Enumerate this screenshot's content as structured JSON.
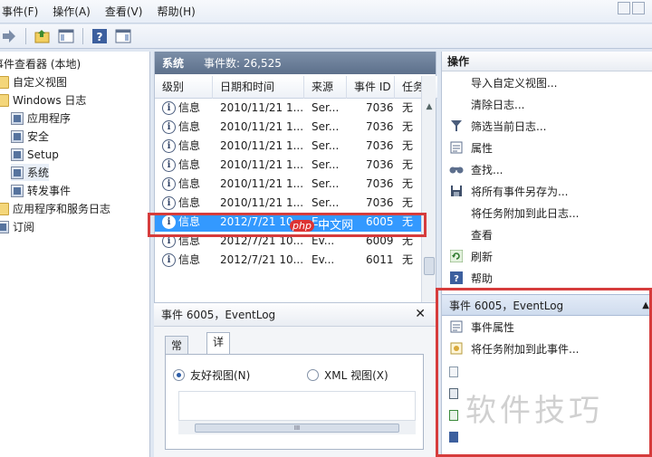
{
  "menu": [
    "事件(F)",
    "操作(A)",
    "查看(V)",
    "帮助(H)"
  ],
  "tree": {
    "items": [
      {
        "label": "事件查看器 (本地)",
        "icon": "event-viewer-icon"
      },
      {
        "label": "自定义视图",
        "icon": "folder-icon"
      },
      {
        "label": "Windows 日志",
        "icon": "folder-icon"
      },
      {
        "label": "应用程序",
        "icon": "log-icon"
      },
      {
        "label": "安全",
        "icon": "log-icon"
      },
      {
        "label": "Setup",
        "icon": "log-icon"
      },
      {
        "label": "系统",
        "icon": "log-icon"
      },
      {
        "label": "转发事件",
        "icon": "log-icon"
      },
      {
        "label": "应用程序和服务日志",
        "icon": "folder-icon"
      },
      {
        "label": "订阅",
        "icon": "log-icon"
      }
    ]
  },
  "log": {
    "name": "系统",
    "count_label": "事件数: 26,525"
  },
  "grid": {
    "columns": [
      "级别",
      "日期和时间",
      "来源",
      "事件 ID",
      "任务"
    ],
    "rows": [
      {
        "level": "信息",
        "datetime": "2010/11/21 1...",
        "source": "Ser...",
        "id": "7036",
        "task": "无"
      },
      {
        "level": "信息",
        "datetime": "2010/11/21 1...",
        "source": "Ser...",
        "id": "7036",
        "task": "无"
      },
      {
        "level": "信息",
        "datetime": "2010/11/21 1...",
        "source": "Ser...",
        "id": "7036",
        "task": "无"
      },
      {
        "level": "信息",
        "datetime": "2010/11/21 1...",
        "source": "Ser...",
        "id": "7036",
        "task": "无"
      },
      {
        "level": "信息",
        "datetime": "2010/11/21 1...",
        "source": "Ser...",
        "id": "7036",
        "task": "无"
      },
      {
        "level": "信息",
        "datetime": "2010/11/21 1...",
        "source": "Ser...",
        "id": "7036",
        "task": "无"
      },
      {
        "level": "信息",
        "datetime": "2012/7/21 10...",
        "source": "E...",
        "id": "6005",
        "task": "无"
      },
      {
        "level": "信息",
        "datetime": "2012/7/21 10...",
        "source": "Ev...",
        "id": "6009",
        "task": "无"
      },
      {
        "level": "信息",
        "datetime": "2012/7/21 10...",
        "source": "Ev...",
        "id": "6011",
        "task": "无"
      }
    ],
    "scroll_thumb_label": "III"
  },
  "detail": {
    "title": "事件 6005，EventLog",
    "close": "✕",
    "tabs": [
      "常规",
      "详细信息"
    ],
    "radio_friendly": "友好视图(N)",
    "radio_xml": "XML 视图(X)"
  },
  "actions": {
    "header": "操作",
    "items": [
      {
        "label": "导入自定义视图...",
        "icon": "import-icon"
      },
      {
        "label": "清除日志...",
        "icon": "none"
      },
      {
        "label": "筛选当前日志...",
        "icon": "filter-icon"
      },
      {
        "label": "属性",
        "icon": "properties-icon"
      },
      {
        "label": "查找...",
        "icon": "find-icon"
      },
      {
        "label": "将所有事件另存为...",
        "icon": "save-icon"
      },
      {
        "label": "将任务附加到此日志...",
        "icon": "none"
      },
      {
        "label": "查看",
        "icon": "none"
      },
      {
        "label": "刷新",
        "icon": "refresh-icon"
      },
      {
        "label": "帮助",
        "icon": "help-icon"
      }
    ],
    "sub_header": "事件 6005，EventLog",
    "sub_items": [
      {
        "label": "事件属性",
        "icon": "properties-icon"
      },
      {
        "label": "将任务附加到此事件...",
        "icon": "task-icon"
      }
    ]
  },
  "watermark": "软件技巧",
  "watermark2": {
    "badge": "php",
    "text": "中文网"
  }
}
